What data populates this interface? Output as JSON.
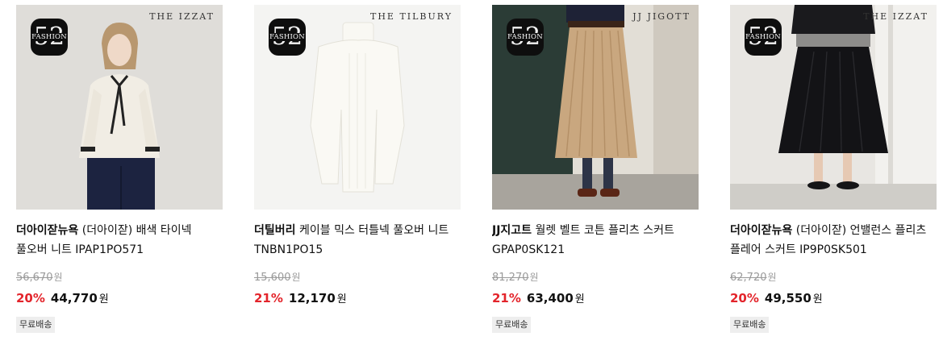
{
  "products": [
    {
      "brand_mark": "THE IZZAT",
      "badge": {
        "num": "52",
        "word": "FASHION"
      },
      "brand": "더아이잗뉴욕",
      "name": " (더아이잗) 배색 타이넥 풀오버 니트 IPAP1PO571",
      "original_price": "56,670",
      "discount": "20%",
      "sale_price": "44,770",
      "currency": "원",
      "shipping_tag": "무료배송"
    },
    {
      "brand_mark": "THE TILBURY",
      "badge": {
        "num": "52",
        "word": "FASHION"
      },
      "brand": "더틸버리",
      "name": " 케이블 믹스 터틀넥 풀오버 니트 TNBN1PO15",
      "original_price": "15,600",
      "discount": "21%",
      "sale_price": "12,170",
      "currency": "원",
      "shipping_tag": ""
    },
    {
      "brand_mark": "JJ JIGOTT",
      "badge": {
        "num": "52",
        "word": "FASHION"
      },
      "brand": "JJ지고트",
      "name": " 월렛 벨트 코튼 플리츠 스커트 GPAP0SK121",
      "original_price": "81,270",
      "discount": "21%",
      "sale_price": "63,400",
      "currency": "원",
      "shipping_tag": "무료배송"
    },
    {
      "brand_mark": "THE IZZAT",
      "badge": {
        "num": "52",
        "word": "FASHION"
      },
      "brand": "더아이잗뉴욕",
      "name": " (더아이잗) 언밸런스 플리츠 플레어 스커트 IP9P0SK501",
      "original_price": "62,720",
      "discount": "20%",
      "sale_price": "49,550",
      "currency": "원",
      "shipping_tag": "무료배송"
    }
  ],
  "colors": {
    "discount": "#e3242b",
    "tag_bg": "#eeeeee",
    "strike": "#9a9a9a"
  }
}
